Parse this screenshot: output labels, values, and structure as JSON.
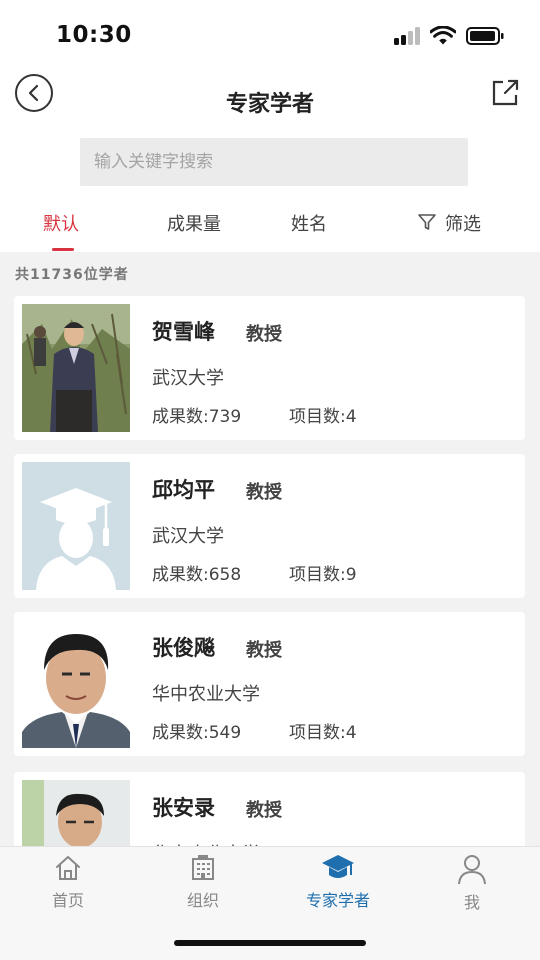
{
  "status": {
    "time": "10:30"
  },
  "header": {
    "title": "专家学者"
  },
  "search": {
    "placeholder": "输入关键字搜索"
  },
  "tabs": [
    {
      "label": "默认",
      "active": true
    },
    {
      "label": "成果量",
      "active": false
    },
    {
      "label": "姓名",
      "active": false
    },
    {
      "label": "筛选",
      "active": false
    }
  ],
  "count_label": "共11736位学者",
  "scholars": [
    {
      "name": "贺雪峰",
      "title": "教授",
      "university": "武汉大学",
      "outputs": "成果数:739",
      "projects": "项目数:4"
    },
    {
      "name": "邱均平",
      "title": "教授",
      "university": "武汉大学",
      "outputs": "成果数:658",
      "projects": "项目数:9"
    },
    {
      "name": "张俊飚",
      "title": "教授",
      "university": "华中农业大学",
      "outputs": "成果数:549",
      "projects": "项目数:4"
    },
    {
      "name": "张安录",
      "title": "教授",
      "university": "华中农业大学",
      "outputs": "",
      "projects": ""
    }
  ],
  "bottom_nav": [
    {
      "label": "首页",
      "icon": "home-icon",
      "active": false
    },
    {
      "label": "组织",
      "icon": "building-icon",
      "active": false
    },
    {
      "label": "专家学者",
      "icon": "graduation-cap-icon",
      "active": true
    },
    {
      "label": "我",
      "icon": "user-icon",
      "active": false
    }
  ],
  "colors": {
    "accent_red": "#d9333f",
    "accent_blue": "#1f6fae"
  }
}
